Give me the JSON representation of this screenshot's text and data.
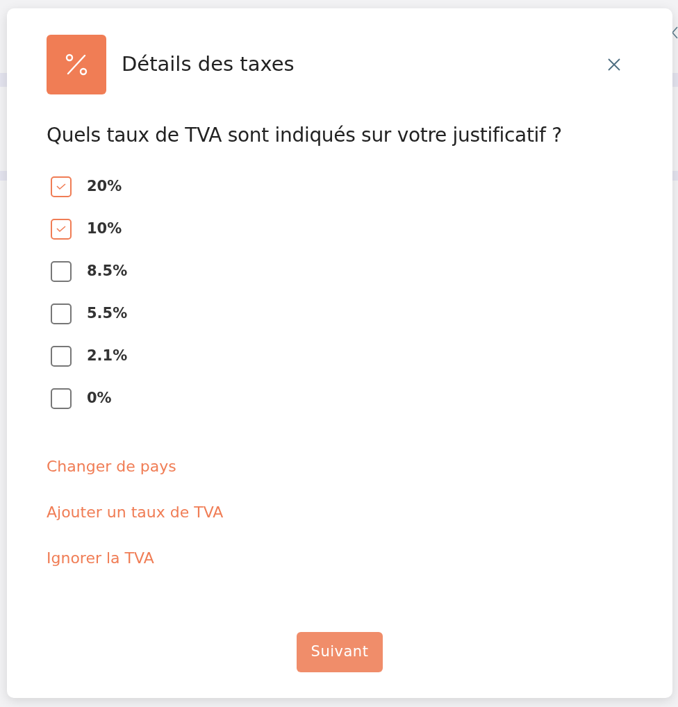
{
  "dialog": {
    "title": "Détails des taxes",
    "question": "Quels taux de TVA sont indiqués sur votre justificatif ?"
  },
  "rates": [
    {
      "label": "20%",
      "checked": true
    },
    {
      "label": "10%",
      "checked": true
    },
    {
      "label": "8.5%",
      "checked": false
    },
    {
      "label": "5.5%",
      "checked": false
    },
    {
      "label": "2.1%",
      "checked": false
    },
    {
      "label": "0%",
      "checked": false
    }
  ],
  "links": [
    "Changer de pays",
    "Ajouter un taux de TVA",
    "Ignorer la TVA"
  ],
  "next_button": "Suivant"
}
